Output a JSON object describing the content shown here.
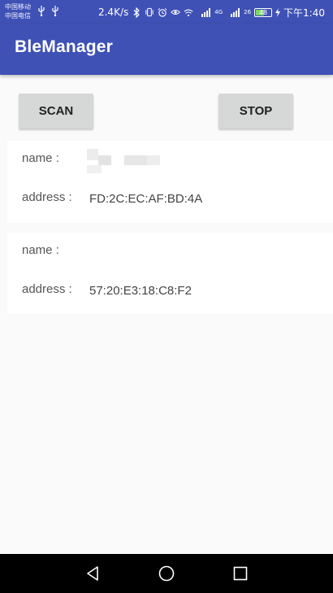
{
  "status_bar": {
    "carrier_1": "中国移动",
    "carrier_2": "中国电信",
    "usb_icons": "ψ ψ",
    "net_speed": "2.4K/s",
    "signal_4g": "4G",
    "signal_26": "26",
    "battery": "48",
    "time": "下午1:40"
  },
  "app": {
    "title": "BleManager"
  },
  "buttons": {
    "scan": "SCAN",
    "stop": "STOP"
  },
  "devices": [
    {
      "name_label": "name :",
      "name_value": "",
      "address_label": "address :",
      "address_value": "FD:2C:EC:AF:BD:4A"
    },
    {
      "name_label": "name :",
      "name_value": "",
      "address_label": "address :",
      "address_value": "57:20:E3:18:C8:F2"
    }
  ],
  "colors": {
    "primary": "#3f51b5",
    "background": "#fafafa",
    "button": "#d6d7d7",
    "nav": "#000000"
  },
  "icons": [
    "usb-icon",
    "bluetooth-icon",
    "vibrate-icon",
    "alarm-icon",
    "eye-icon",
    "wifi-icon",
    "signal-icon",
    "battery-icon",
    "charging-icon",
    "back-icon",
    "home-icon",
    "recents-icon"
  ]
}
